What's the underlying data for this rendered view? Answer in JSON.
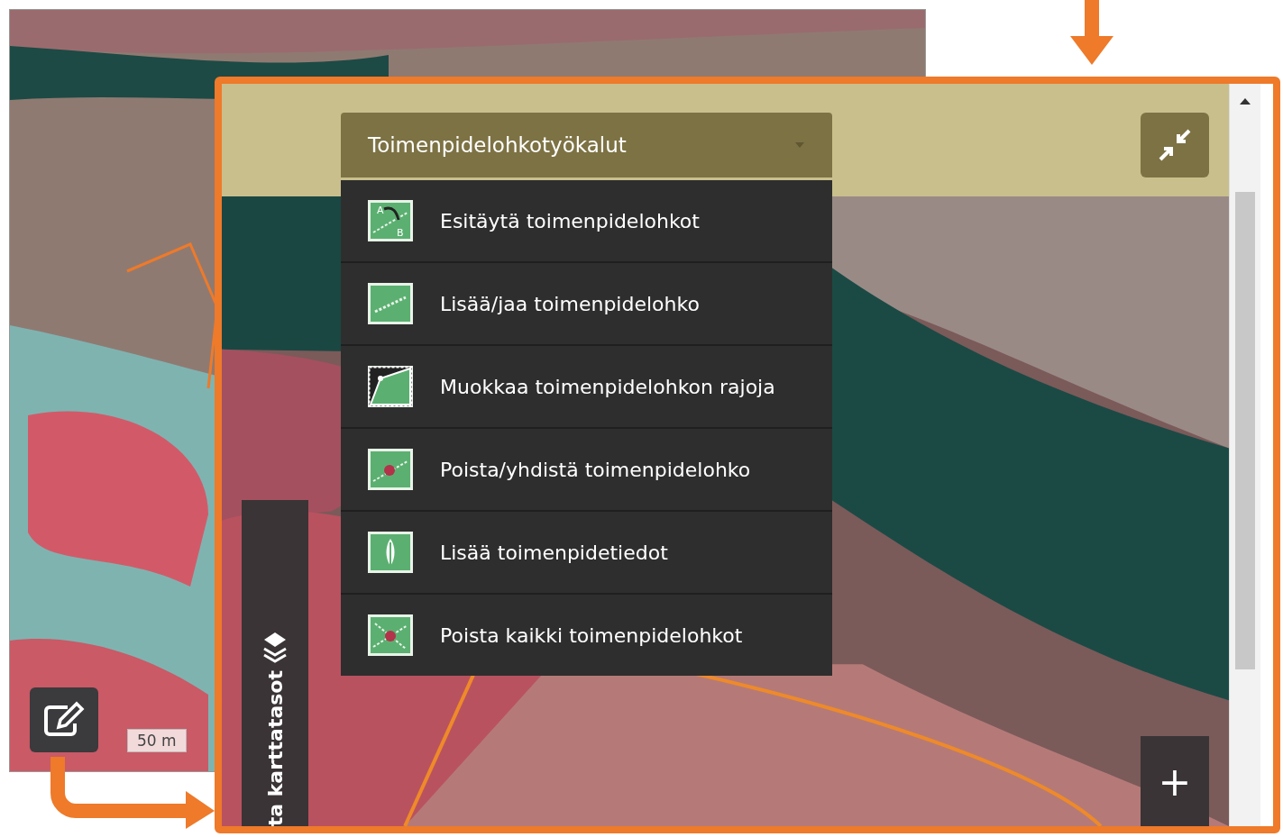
{
  "background_map": {
    "scale": "50 m"
  },
  "panel": {
    "dropdown": {
      "label": "Toimenpidelohkotyökalut",
      "expanded": true
    },
    "menu_items": [
      {
        "label": "Esitäytä toimenpidelohkot",
        "kind": "prefill",
        "icon_letters": [
          "A",
          "B"
        ]
      },
      {
        "label": "Lisää/jaa toimenpidelohko",
        "kind": "split"
      },
      {
        "label": "Muokkaa toimenpidelohkon rajoja",
        "kind": "edit"
      },
      {
        "label": "Poista/yhdistä toimenpidelohko",
        "kind": "delete"
      },
      {
        "label": "Lisää toimenpidetiedot",
        "kind": "info"
      },
      {
        "label": "Poista kaikki toimenpidelohkot",
        "kind": "delete_all"
      }
    ],
    "side_tab": {
      "label": "ta karttatasot"
    },
    "zoom_button": {
      "label": "+"
    }
  }
}
